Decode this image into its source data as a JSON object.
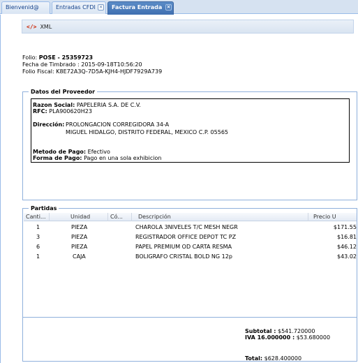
{
  "tabs": [
    {
      "label": "Bienvenid@",
      "closable": false
    },
    {
      "label": "Entradas CFDI",
      "closable": true
    },
    {
      "label": "Factura Entrada",
      "closable": true
    }
  ],
  "toolbar": {
    "xml_icon": "</>",
    "xml_label": "XML"
  },
  "header": {
    "folio_label": "Folio:",
    "folio_value": "POSE - 25359723",
    "fecha_label": "Fecha de Timbrado :",
    "fecha_value": "2015-09-18T10:56:20",
    "folio_fiscal_label": "Folio Fiscal:",
    "folio_fiscal_value": "K8E72A3Q-7D5A-KJH4-HJDF7929A739"
  },
  "proveedor": {
    "legend": "Datos del Proveedor",
    "razon_label": "Razon Social:",
    "razon_value": "PAPELERIA S.A. DE C.V.",
    "rfc_label": "RFC:",
    "rfc_value": "PLA900620H23",
    "direccion_label": "Dirección:",
    "direccion_line1": "PROLONGACION CORREGIDORA 34-A",
    "direccion_line2": "MIGUEL HIDALGO, DISTRITO FEDERAL, MEXICO C.P. 05565",
    "metodo_label": "Metodo de Pago:",
    "metodo_value": "Efectivo",
    "forma_label": "Forma de Pago:",
    "forma_value": "Pago en una sola exhibicion"
  },
  "partidas": {
    "legend": "Partidas",
    "columns": [
      "Canti...",
      "Unidad",
      "Có...",
      "Descripción",
      "Precio U"
    ],
    "rows": [
      {
        "cantidad": "1",
        "unidad": "PIEZA",
        "codigo": "",
        "descripcion": "CHAROLA 3NIVELES T/C MESH NEGR",
        "precio": "$171.55"
      },
      {
        "cantidad": "3",
        "unidad": "PIEZA",
        "codigo": "",
        "descripcion": "REGISTRADOR OFFICE DEPOT TC PZ",
        "precio": "$16.81"
      },
      {
        "cantidad": "6",
        "unidad": "PIEZA",
        "codigo": "",
        "descripcion": "PAPEL PREMIUM OD CARTA RESMA",
        "precio": "$46.12"
      },
      {
        "cantidad": "1",
        "unidad": "CAJA",
        "codigo": "",
        "descripcion": "BOLIGRAFO CRISTAL BOLD NG 12p",
        "precio": "$43.02"
      }
    ]
  },
  "totals": {
    "subtotal_label": "Subtotal :",
    "subtotal_value": "$541.720000",
    "iva_label": "IVA 16.000000 :",
    "iva_value": "$53.680000",
    "total_label": "Total:",
    "total_value": "$628.400000"
  }
}
